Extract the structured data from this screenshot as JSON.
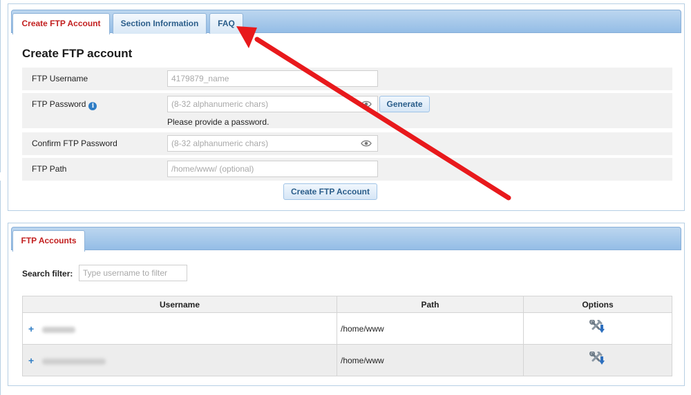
{
  "tabs": [
    "Create FTP Account",
    "Section Information",
    "FAQ"
  ],
  "create_form": {
    "heading": "Create FTP account",
    "username_label": "FTP Username",
    "username_placeholder": "4179879_name",
    "password_label": "FTP Password",
    "password_placeholder": "(8-32 alphanumeric chars)",
    "generate_label": "Generate",
    "password_hint": "Please provide a password.",
    "confirm_label": "Confirm FTP Password",
    "confirm_placeholder": "(8-32 alphanumeric chars)",
    "path_label": "FTP Path",
    "path_placeholder": "/home/www/ (optional)",
    "submit_label": "Create FTP Account"
  },
  "accounts": {
    "tab_label": "FTP Accounts",
    "filter_label": "Search filter:",
    "filter_placeholder": "Type username to filter",
    "columns": [
      "Username",
      "Path",
      "Options"
    ],
    "rows": [
      {
        "expand": "+",
        "path": "/home/www"
      },
      {
        "expand": "+",
        "path": "/home/www"
      }
    ]
  },
  "icons": {
    "info": "info-icon",
    "eye": "eye-icon",
    "options": "tools-icon",
    "annotation": "red-arrow-annotation"
  },
  "colors": {
    "active_tab_text": "#c21f1f",
    "tab_text": "#2a5d8a",
    "tabbar": "#a9cbeb",
    "annotation_arrow": "#e8191c"
  }
}
